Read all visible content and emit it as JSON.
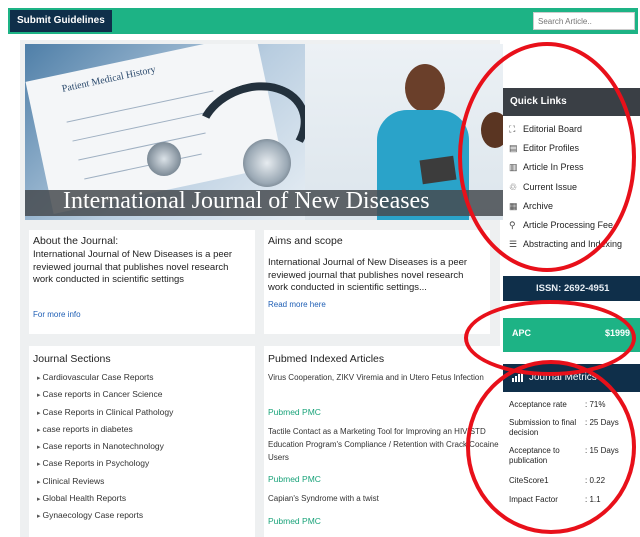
{
  "topbar": {
    "submit_label": "Submit Guidelines",
    "search_placeholder": "Search Article.."
  },
  "hero": {
    "paper_label": "Patient Medical History",
    "banner_title": "International Journal of New Diseases"
  },
  "about": {
    "title": "About the Journal:",
    "text": "International Journal of New Diseases is a peer reviewed journal that publishes novel research work conducted in scientific settings",
    "link": "For more info"
  },
  "aims": {
    "title": "Aims and scope",
    "text": "International Journal of New Diseases is a peer reviewed journal that publishes novel research work conducted in scientific settings...",
    "link": "Read more here"
  },
  "sections": {
    "title": "Journal Sections",
    "items": [
      "Cardiovascular Case Reports",
      "Case reports in Cancer Science",
      "Case Reports in Clinical Pathology",
      "case reports in diabetes",
      "Case reports in Nanotechnology",
      "Case Reports in Psychology",
      "Clinical Reviews",
      "Global Health Reports",
      "Gynaecology Case reports"
    ]
  },
  "pubmed": {
    "title": "Pubmed Indexed Articles",
    "articles": [
      {
        "title": "Virus Cooperation, ZIKV Viremia and in Utero Fetus Infection",
        "links": "Pubmed PMC"
      },
      {
        "title": "Tactile Contact as a Marketing Tool for Improving an HIV/STD Education Program's Compliance / Retention with Crack Cocaine Users",
        "links": "Pubmed PMC"
      },
      {
        "title": "Capian's Syndrome with a twist",
        "links": "Pubmed PMC"
      }
    ]
  },
  "quick_links": {
    "title": "Quick Links",
    "items": [
      {
        "icon": "board-icon",
        "glyph": "⛶",
        "label": "Editorial Board"
      },
      {
        "icon": "profile-icon",
        "glyph": "▤",
        "label": "Editor Profiles"
      },
      {
        "icon": "article-icon",
        "glyph": "▥",
        "label": "Article In Press"
      },
      {
        "icon": "issue-icon",
        "glyph": "♲",
        "label": "Current Issue"
      },
      {
        "icon": "archive-icon",
        "glyph": "▦",
        "label": "Archive"
      },
      {
        "icon": "fee-icon",
        "glyph": "⚲",
        "label": "Article Processing Fee"
      },
      {
        "icon": "index-icon",
        "glyph": "☰",
        "label": "Abstracting and Indexing"
      }
    ]
  },
  "issn": {
    "text": "ISSN: 2692-4951"
  },
  "apc": {
    "label": "APC",
    "value": "$1999"
  },
  "metrics": {
    "title": "Journal Metrics",
    "rows": [
      {
        "label": "Acceptance rate",
        "value": ": 71%"
      },
      {
        "label": "Submission to final decision",
        "value": ": 25 Days"
      },
      {
        "label": "Acceptance to publication",
        "value": ": 15 Days"
      },
      {
        "label": "CiteScore1",
        "value": ": 0.22"
      },
      {
        "label": "Impact Factor",
        "value": ": 1.1"
      }
    ]
  },
  "colors": {
    "brand_green": "#1db385",
    "navy": "#0f2f4a",
    "annotation_red": "#e8101a"
  }
}
